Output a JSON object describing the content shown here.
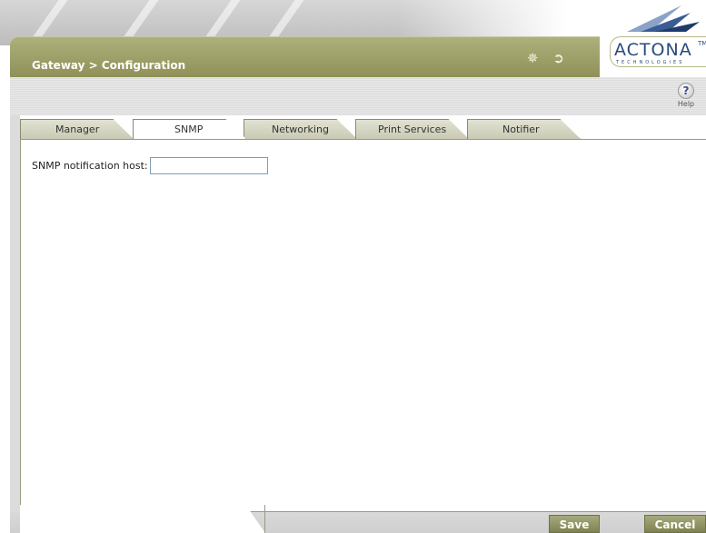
{
  "header": {
    "breadcrumb": "Gateway > Configuration",
    "icons": [
      "wand-icon",
      "logout-icon"
    ],
    "colors": {
      "bar": "#9a9c66",
      "accent": "#2a4a7a"
    }
  },
  "logo": {
    "text": "ACTONA",
    "tm": "TM",
    "sub": "TECHNOLOGIES"
  },
  "help": {
    "label": "Help",
    "glyph": "?"
  },
  "tabs": [
    {
      "label": "Manager",
      "active": false
    },
    {
      "label": "SNMP",
      "active": true
    },
    {
      "label": "Networking",
      "active": false
    },
    {
      "label": "Print Services",
      "active": false
    },
    {
      "label": "Notifier",
      "active": false
    }
  ],
  "form": {
    "snmp_host": {
      "label": "SNMP notification host:",
      "value": "",
      "placeholder": ""
    }
  },
  "actions": {
    "save": "Save",
    "cancel": "Cancel"
  }
}
